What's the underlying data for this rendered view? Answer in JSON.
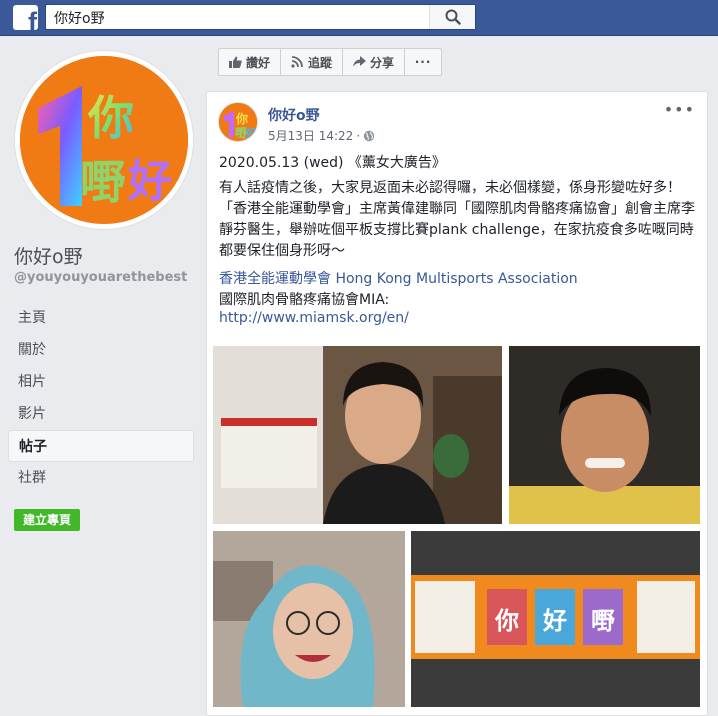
{
  "topbar": {
    "logo_letter": "f",
    "search_value": "你好o野"
  },
  "left": {
    "page_name": "你好o野",
    "handle": "@youyouyouarethebest",
    "nav": [
      "主頁",
      "關於",
      "相片",
      "影片",
      "帖子",
      "社群"
    ],
    "active_nav_index": 4,
    "create_page_label": "建立專頁"
  },
  "actions": {
    "like": "讚好",
    "follow": "追蹤",
    "share": "分享",
    "more": "···"
  },
  "post": {
    "author": "你好o野",
    "date": "5月13日 14:22",
    "privacy_icon": "globe-icon",
    "more": "•••",
    "title": "2020.05.13 (wed) 《薰女大廣告》",
    "body": "有人話疫情之後，大家見返面未必認得囉，未必個樣變，係身形變咗好多！「香港全能運動學會」主席黃偉建聯同「國際肌肉骨骼疼痛協會」創會主席李靜芬醫生，舉辦咗個平板支撐比賽plank challenge，在家抗疫食多咗嘅同時都要保住個身形呀～",
    "link_org": "香港全能運動學會 Hong Kong Multisports Association",
    "line_mia": "國際肌肉骨骼疼痛協會MIA:",
    "link_url": "http://www.miamsk.org/en/"
  },
  "colors": {
    "brand_blue": "#3b5998",
    "link_blue": "#385898",
    "green": "#42b72a",
    "avatar_orange": "#f07a14"
  }
}
